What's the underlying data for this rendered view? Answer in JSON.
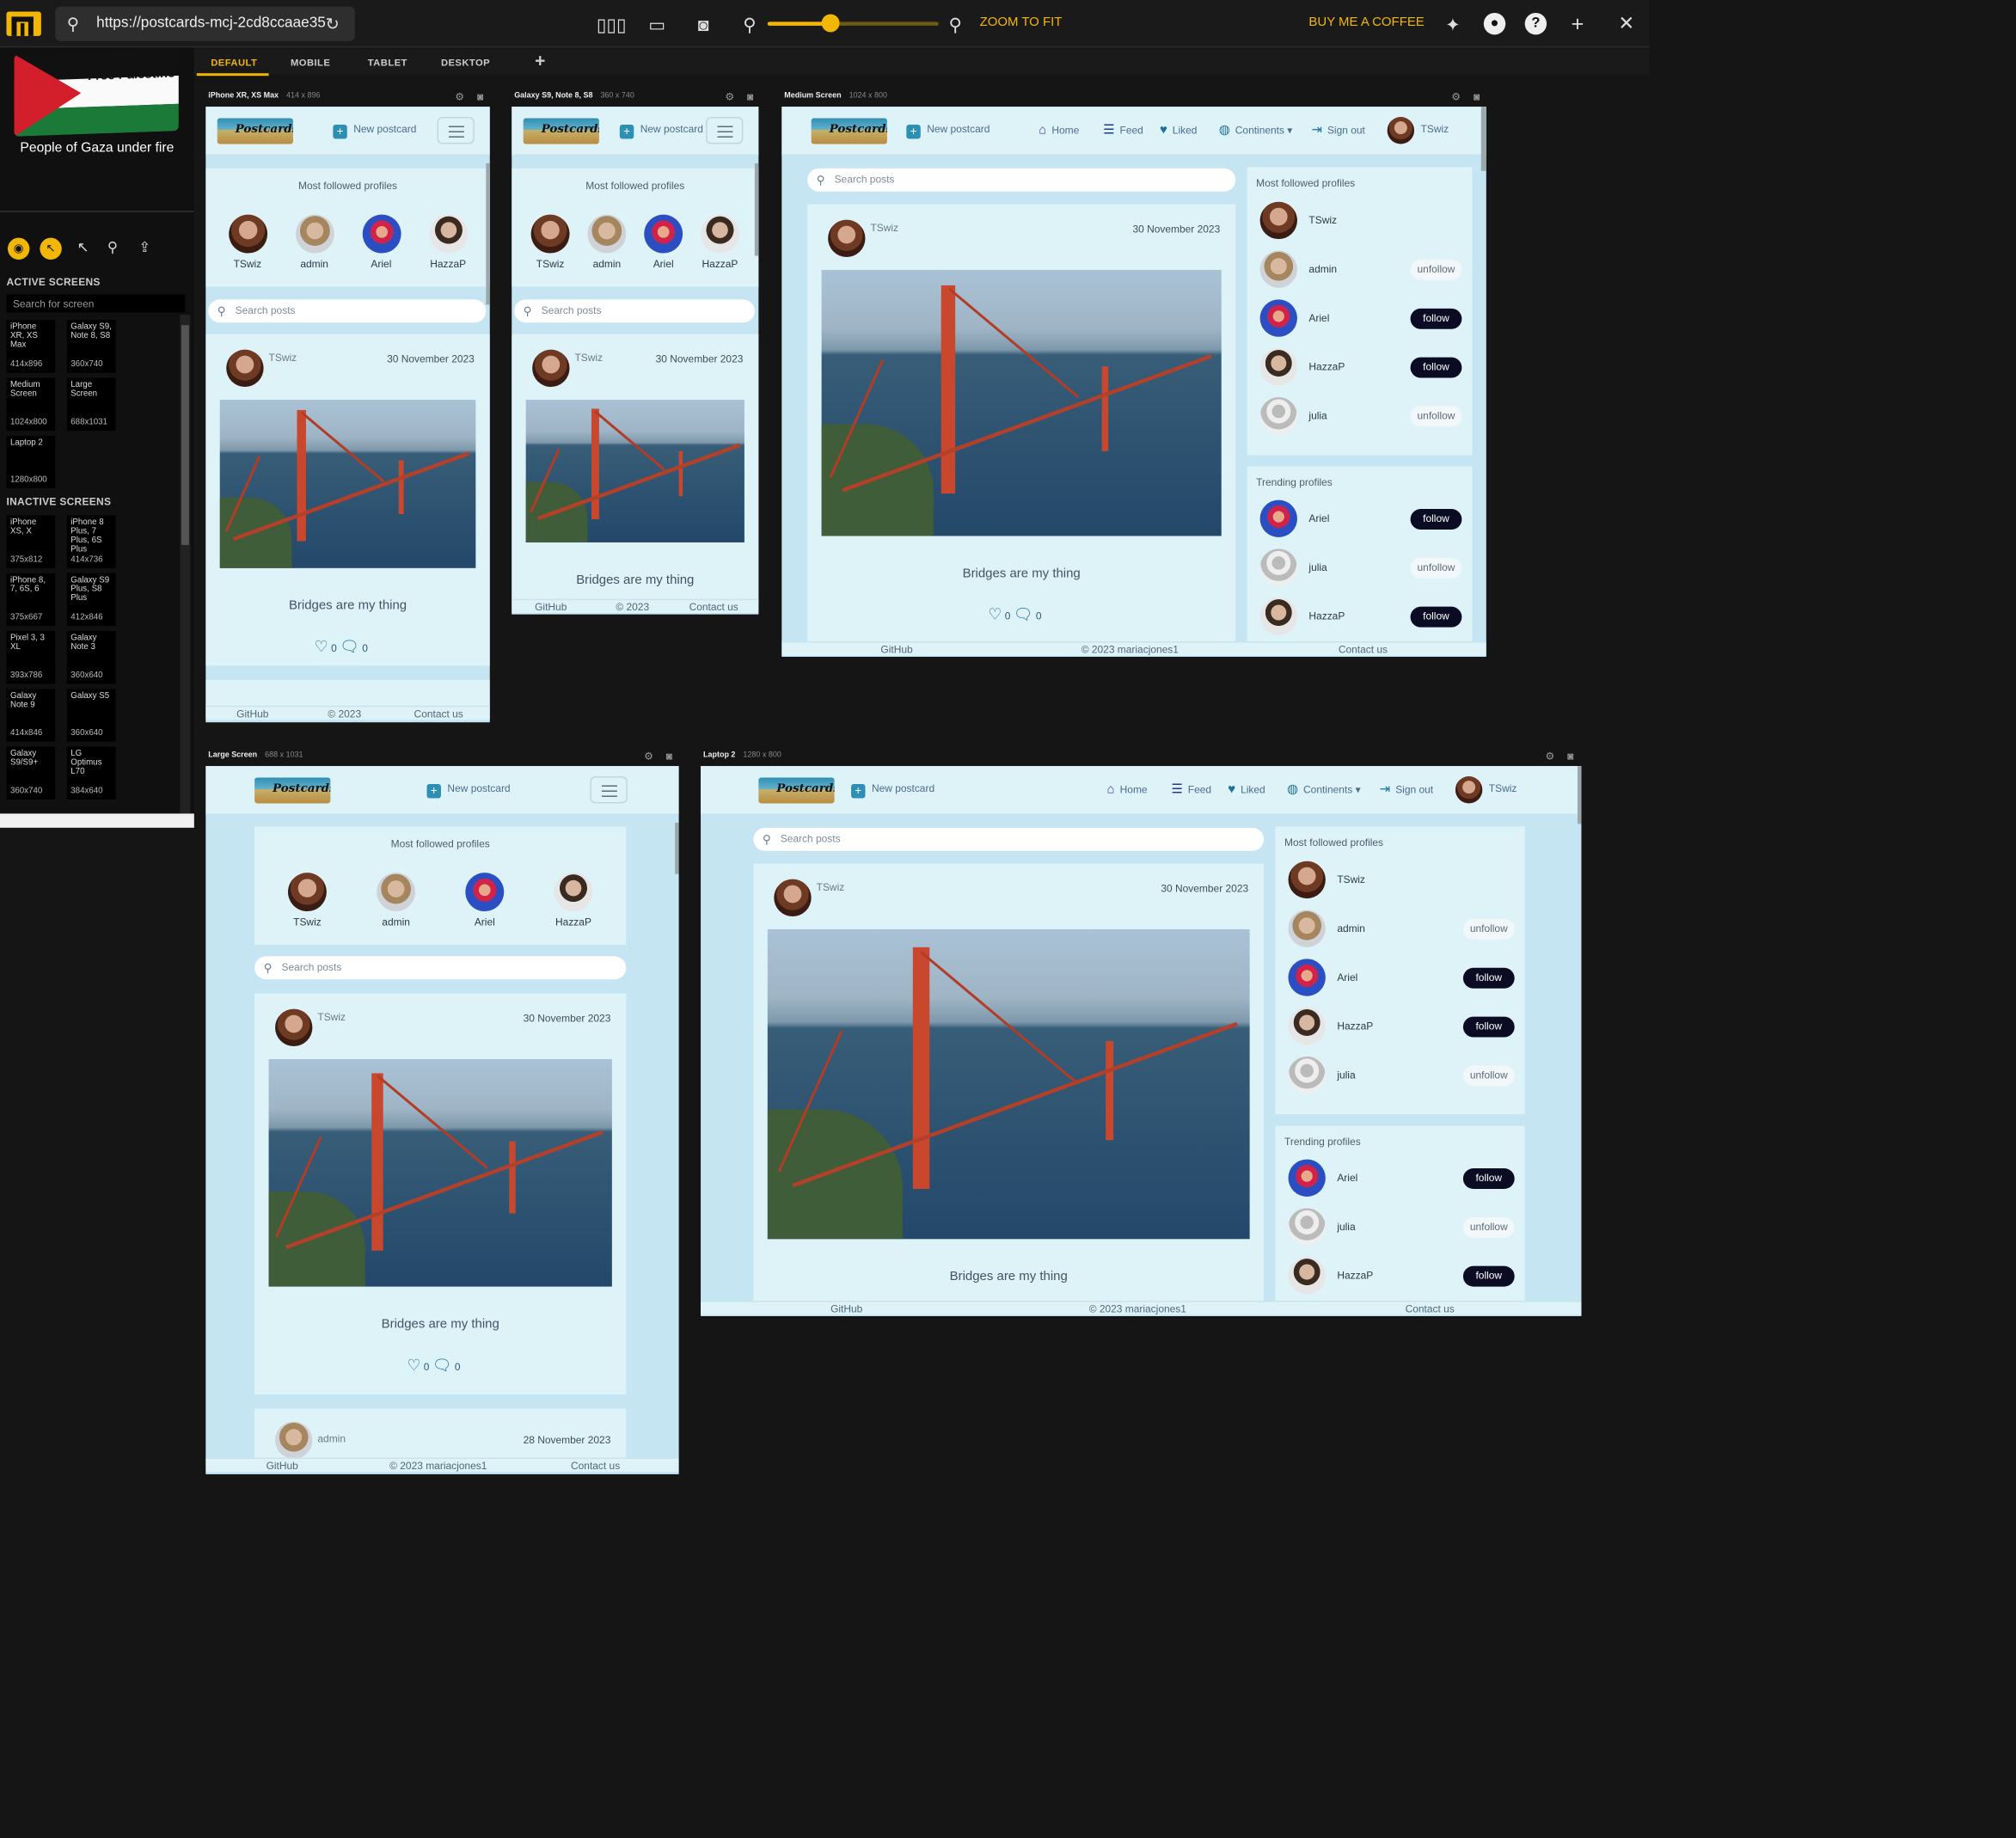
{
  "topbar": {
    "url": "https://postcards-mcj-2cd8ccaae35",
    "zoom_to_fit": "ZOOM TO FIT",
    "buy_coffee": "BUY ME A COFFEE",
    "zoom_level": 0.37,
    "accent": "#f2b705"
  },
  "sidebar": {
    "flag_text": "Free Palestine",
    "gaza": "People of Gaza under fire",
    "active_heading": "ACTIVE SCREENS",
    "search_placeholder": "Search for screen",
    "inactive_heading": "INACTIVE SCREENS",
    "active": [
      {
        "name": "iPhone XR, XS Max",
        "size": "414x896"
      },
      {
        "name": "Galaxy S9, Note 8, S8",
        "size": "360x740"
      },
      {
        "name": "Medium Screen",
        "size": "1024x800"
      },
      {
        "name": "Large Screen",
        "size": "688x1031"
      },
      {
        "name": "Laptop 2",
        "size": "1280x800"
      }
    ],
    "inactive": [
      {
        "name": "iPhone XS, X",
        "size": "375x812"
      },
      {
        "name": "iPhone 8 Plus, 7 Plus, 6S Plus",
        "size": "414x736"
      },
      {
        "name": "iPhone 8, 7, 6S, 6",
        "size": "375x667"
      },
      {
        "name": "Galaxy S9 Plus, S8 Plus",
        "size": "412x846"
      },
      {
        "name": "Pixel 3, 3 XL",
        "size": "393x786"
      },
      {
        "name": "Galaxy Note 3",
        "size": "360x640"
      },
      {
        "name": "Galaxy Note 9",
        "size": "414x846"
      },
      {
        "name": "Galaxy S5",
        "size": "360x640"
      },
      {
        "name": "Galaxy S9/S9+",
        "size": "360x740"
      },
      {
        "name": "LG Optimus L70",
        "size": "384x640"
      }
    ]
  },
  "tabs": [
    "DEFAULT",
    "MOBILE",
    "TABLET",
    "DESKTOP"
  ],
  "frames": {
    "iphone": {
      "name": "iPhone XR, XS Max",
      "size": "414 x 896"
    },
    "galaxy": {
      "name": "Galaxy S9, Note 8, S8",
      "size": "360 x 740"
    },
    "medium": {
      "name": "Medium Screen",
      "size": "1024 x 800"
    },
    "large": {
      "name": "Large Screen",
      "size": "688 x 1031"
    },
    "laptop": {
      "name": "Laptop 2",
      "size": "1280 x 800"
    }
  },
  "site": {
    "new_postcard": "New postcard",
    "nav": {
      "home": "Home",
      "feed": "Feed",
      "liked": "Liked",
      "continents": "Continents",
      "signout": "Sign out",
      "user": "TSwiz"
    },
    "most_followed": "Most followed profiles",
    "trending": "Trending profiles",
    "search_placeholder": "Search posts",
    "profiles": [
      "TSwiz",
      "admin",
      "Ariel",
      "HazzaP",
      "julia"
    ],
    "follow_list": [
      {
        "name": "TSwiz",
        "btn": ""
      },
      {
        "name": "admin",
        "btn": "unfollow"
      },
      {
        "name": "Ariel",
        "btn": "follow"
      },
      {
        "name": "HazzaP",
        "btn": "follow"
      },
      {
        "name": "julia",
        "btn": "unfollow"
      }
    ],
    "trending_list": [
      {
        "name": "Ariel",
        "btn": "follow"
      },
      {
        "name": "julia",
        "btn": "unfollow"
      },
      {
        "name": "HazzaP",
        "btn": "follow"
      }
    ],
    "post": {
      "author": "TSwiz",
      "date": "30 November 2023",
      "caption": "Bridges are my thing",
      "likes": "0",
      "comments": "0"
    },
    "post2": {
      "author": "admin",
      "date": "28 November 2023"
    },
    "footer": {
      "github": "GitHub",
      "copyright_short": "© 2023",
      "copyright": "© 2023 mariacjones1",
      "contact": "Contact us"
    }
  }
}
